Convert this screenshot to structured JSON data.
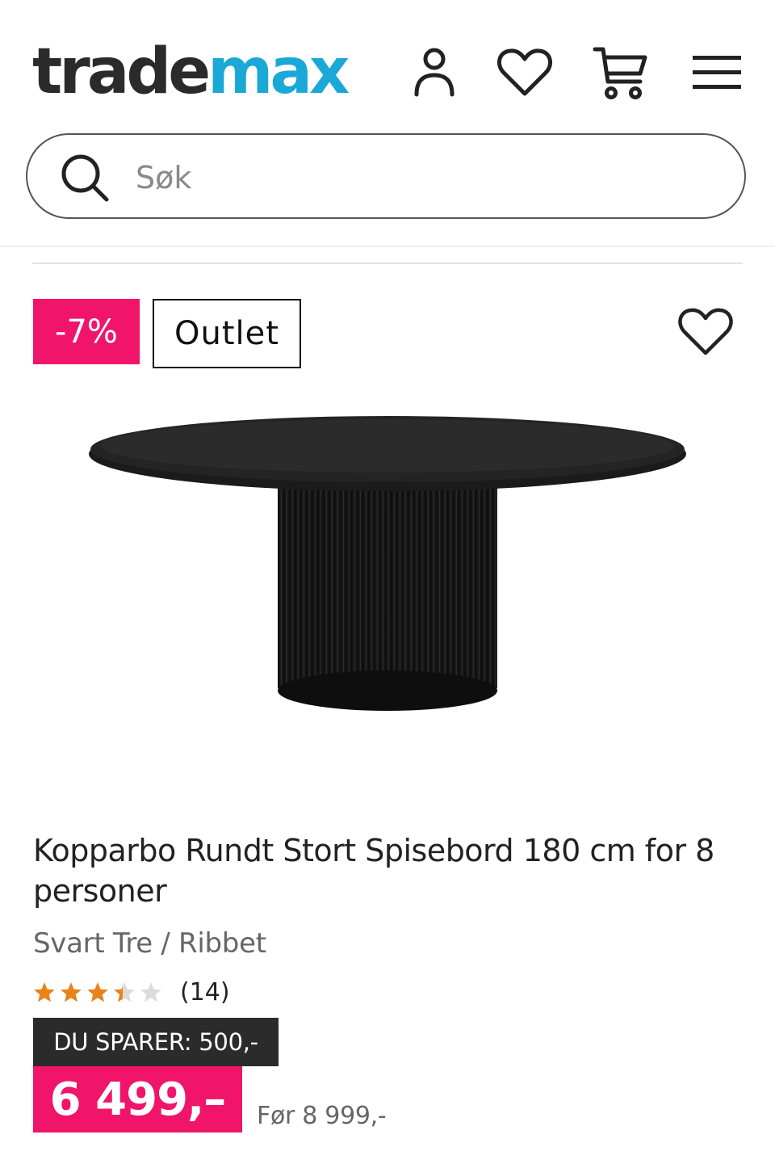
{
  "header": {
    "logo_part1": "trade",
    "logo_part2": "max",
    "icons": [
      "user-icon",
      "heart-icon",
      "cart-icon",
      "menu-icon"
    ]
  },
  "search": {
    "placeholder": "Søk",
    "value": ""
  },
  "product": {
    "discount_badge": "-7%",
    "outlet_badge": "Outlet",
    "title": "Kopparbo Rundt Stort Spisebord 180 cm for 8 personer",
    "variant": "Svart Tre / Ribbet",
    "rating": 3.5,
    "rating_max": 5,
    "review_count": "(14)",
    "savings": "DU SPARER: 500,-",
    "price": "6 499,–",
    "old_price": "Før 8 999,-"
  },
  "colors": {
    "brand_dark": "#2b2b2b",
    "brand_blue": "#1aa8d6",
    "accent_pink": "#f0146b",
    "star_orange": "#e8831a"
  }
}
